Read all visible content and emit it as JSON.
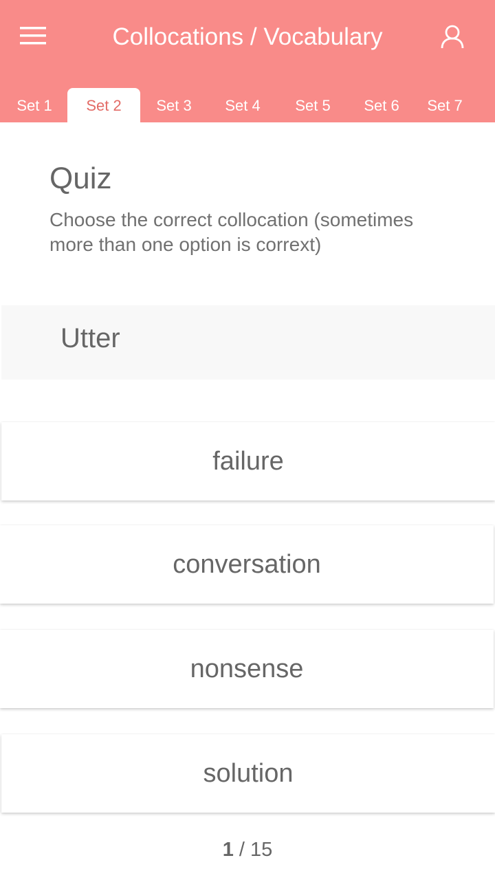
{
  "header": {
    "title": "Collocations / Vocabulary",
    "background_color": "#f98b89",
    "menu_icon": "hamburger-menu-icon",
    "user_icon": "user-profile-icon"
  },
  "tabs": [
    {
      "label": "Set 1",
      "active": false
    },
    {
      "label": "Set 2",
      "active": true
    },
    {
      "label": "Set 3",
      "active": false
    },
    {
      "label": "Set 4",
      "active": false
    },
    {
      "label": "Set 5",
      "active": false
    },
    {
      "label": "Set 6",
      "active": false
    },
    {
      "label": "Set 7",
      "active": false
    }
  ],
  "quiz": {
    "title": "Quiz",
    "instructions": "Choose the correct collocation (sometimes more than one option is corrext)",
    "word": "Utter",
    "options": [
      "failure",
      "conversation",
      "nonsense",
      "solution"
    ]
  },
  "pager": {
    "current": "1",
    "separator": " / ",
    "total": "15"
  }
}
